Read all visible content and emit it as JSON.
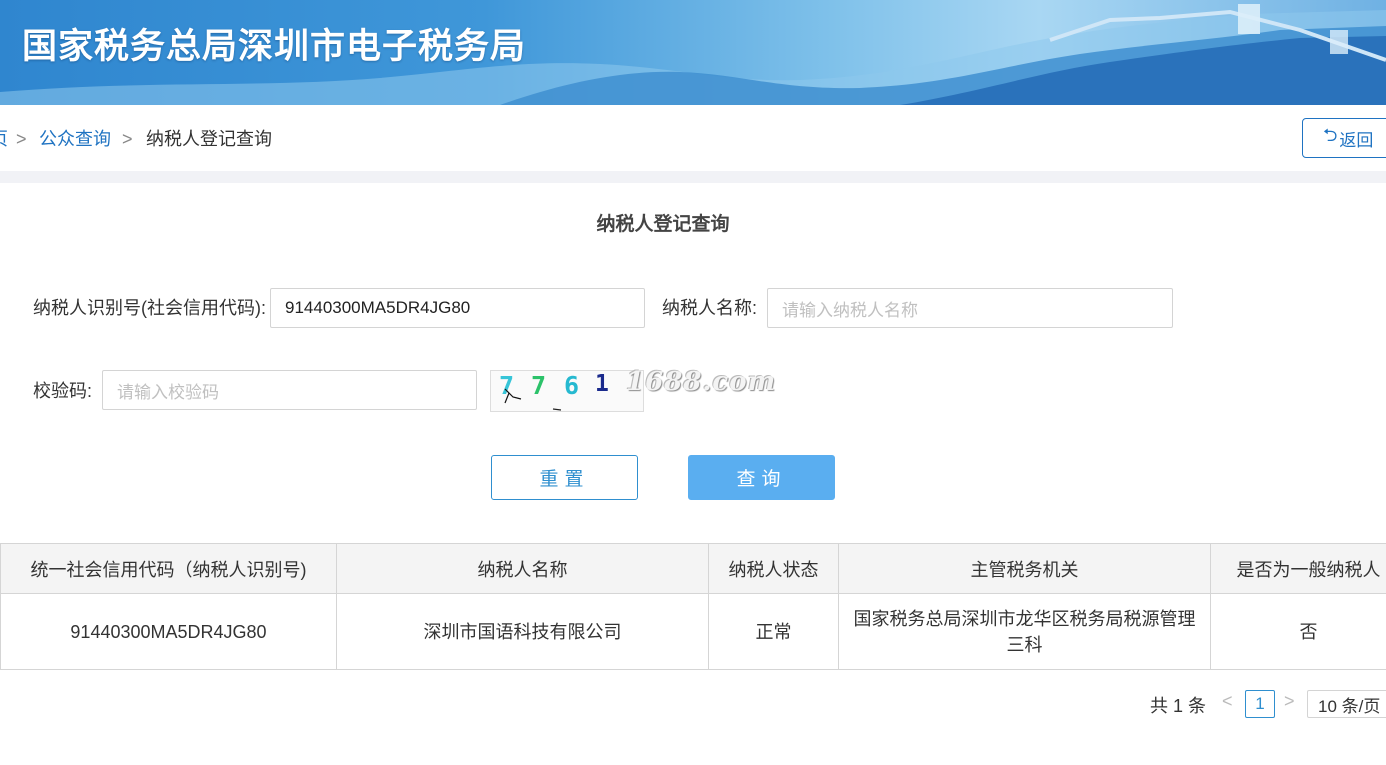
{
  "banner": {
    "title": "国家税务总局深圳市电子税务局"
  },
  "breadcrumb": {
    "items": [
      {
        "label": "页"
      },
      {
        "label": "公众查询"
      },
      {
        "label": "纳税人登记查询"
      }
    ],
    "separator": ">"
  },
  "back_button": {
    "label": "返回",
    "icon": "return-icon"
  },
  "form": {
    "title": "纳税人登记查询",
    "tax_id_label": "纳税人识别号(社会信用代码):",
    "tax_id_value": "91440300MA5DR4JG80",
    "name_label": "纳税人名称:",
    "name_placeholder": "请输入纳税人名称",
    "captcha_label": "校验码:",
    "captcha_placeholder": "请输入校验码",
    "captcha_chars": [
      "7",
      "7",
      "6",
      "1"
    ],
    "captcha_colors": [
      "#37c5d8",
      "#2cc26a",
      "#26b9d0",
      "#1a2a8c"
    ],
    "watermark": "1688.com",
    "reset_label": "重置",
    "query_label": "查询"
  },
  "table": {
    "headers": [
      "统一社会信用代码（纳税人识别号)",
      "纳税人名称",
      "纳税人状态",
      "主管税务机关",
      "是否为一般纳税人"
    ],
    "rows": [
      [
        "91440300MA5DR4JG80",
        "深圳市国语科技有限公司",
        "正常",
        "国家税务总局深圳市龙华区税务局税源管理三科",
        "否"
      ]
    ]
  },
  "pagination": {
    "total": "共 1 条",
    "current_page": "1",
    "page_size": "10 条/页"
  },
  "colors": {
    "accent": "#1f73c2",
    "primary_button": "#5aaef0"
  }
}
